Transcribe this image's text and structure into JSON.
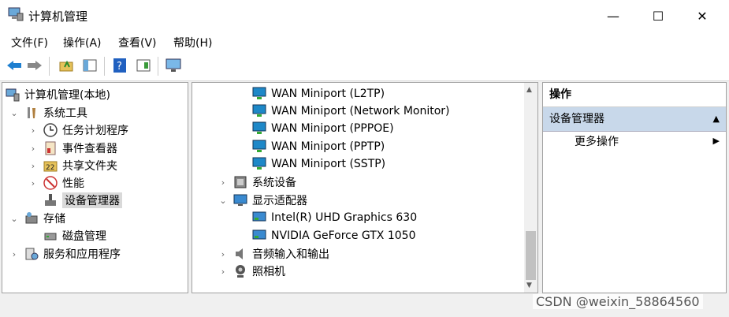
{
  "window": {
    "title": "计算机管理",
    "minimize": "—",
    "maximize": "☐",
    "close": "✕"
  },
  "menu": [
    "文件(F)",
    "操作(A)",
    "查看(V)",
    "帮助(H)"
  ],
  "toolbar": {
    "icons": [
      "back-arrow-icon",
      "forward-arrow-icon",
      "up-folder-icon",
      "show-hide-tree-icon",
      "help-icon",
      "properties-icon",
      "monitor-icon"
    ]
  },
  "tree": {
    "root": "计算机管理(本地)",
    "system_tools": "系统工具",
    "task_scheduler": "任务计划程序",
    "event_viewer": "事件查看器",
    "shared_folders": "共享文件夹",
    "performance": "性能",
    "device_manager": "设备管理器",
    "storage": "存储",
    "disk_management": "磁盘管理",
    "services_apps": "服务和应用程序"
  },
  "devices": {
    "wan": [
      "WAN Miniport (L2TP)",
      "WAN Miniport (Network Monitor)",
      "WAN Miniport (PPPOE)",
      "WAN Miniport (PPTP)",
      "WAN Miniport (SSTP)"
    ],
    "system_devices": "系统设备",
    "display_adapters": "显示适配器",
    "gpus": [
      "Intel(R) UHD Graphics 630",
      "NVIDIA GeForce GTX 1050"
    ],
    "audio": "音频输入和输出",
    "camera": "照相机"
  },
  "actions": {
    "header": "操作",
    "section": "设备管理器",
    "more": "更多操作"
  },
  "watermark": "CSDN @weixin_58864560",
  "colors": {
    "selected_section": "#c8d8ea",
    "selection": "#d9d9d9",
    "network_icon": "#1e88c8"
  }
}
